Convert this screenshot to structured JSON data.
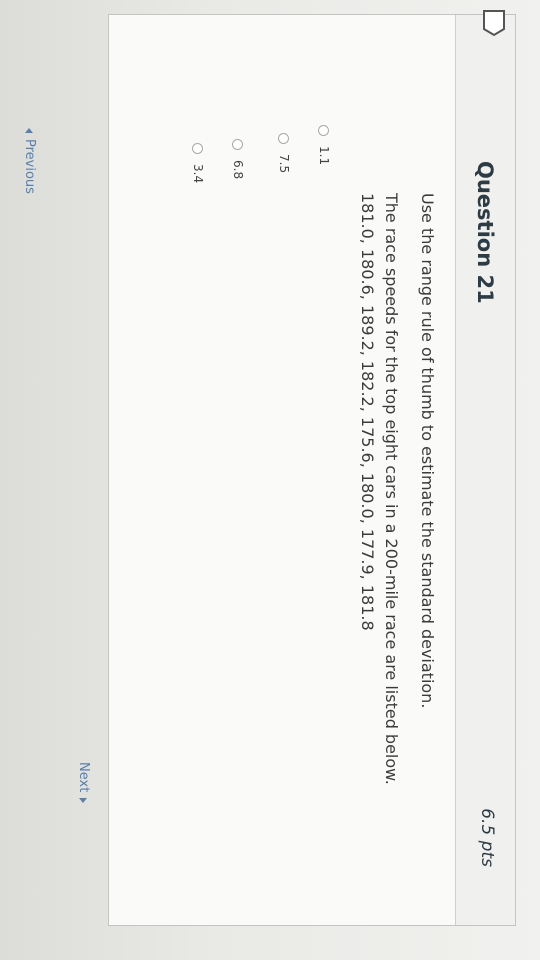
{
  "question": {
    "title": "Question 21",
    "points": "6.5 pts",
    "instruction": "Use the range rule of thumb to estimate the standard deviation.",
    "prompt": "The race speeds for the top eight cars in a 200-mile race are listed below.",
    "data": "181.0, 180.6, 189.2, 182.2, 175.6, 180.0, 177.9, 181.8",
    "choices": [
      "1.1",
      "7.5",
      "6.8",
      "3.4"
    ]
  },
  "nav": {
    "previous_label": "Previous",
    "next_label": "Next"
  },
  "colors": {
    "link": "#5a7fa8",
    "text": "#3b3b3b",
    "title": "#2d3b45",
    "taskbar": "#2a5f91"
  },
  "icons": [
    "flag-icon",
    "chevron-left-icon",
    "chevron-right-icon",
    "radio-icon"
  ]
}
